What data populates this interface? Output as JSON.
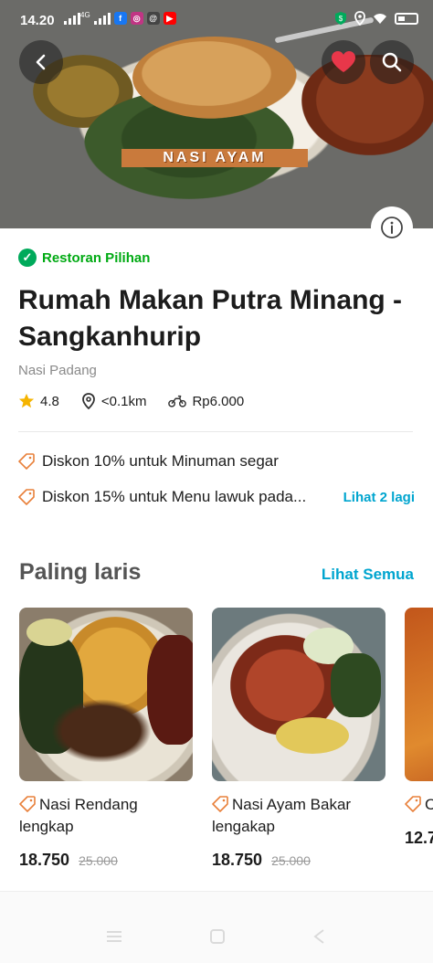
{
  "status_bar": {
    "time": "14.20",
    "network": "4G",
    "apps": [
      {
        "name": "facebook-icon",
        "glyph": "f",
        "color": "#1877f2"
      },
      {
        "name": "instagram-icon",
        "glyph": "◎",
        "color": "#c13584"
      },
      {
        "name": "threads-icon",
        "glyph": "@",
        "color": "#333333"
      },
      {
        "name": "youtube-icon",
        "glyph": "▶",
        "color": "#ff0000"
      }
    ]
  },
  "hero": {
    "caption": "NASI AYAM"
  },
  "restaurant": {
    "badge": "Restoran Pilihan",
    "name": "Rumah Makan Putra Minang - Sangkanhurip",
    "cuisine": "Nasi Padang",
    "rating": "4.8",
    "distance": "<0.1km",
    "delivery_fee": "Rp6.000"
  },
  "promos": [
    {
      "text": "Diskon 10% untuk Minuman segar"
    },
    {
      "text": "Diskon 15% untuk Menu lawuk pada..."
    }
  ],
  "promos_more": "Lihat 2 lagi",
  "bestseller": {
    "title": "Paling laris",
    "see_all": "Lihat Semua",
    "items": [
      {
        "name": "Nasi Rendang lengkap",
        "price": "18.750",
        "original_price": "25.000"
      },
      {
        "name": "Nasi Ayam Bakar lengakap",
        "price": "18.750",
        "original_price": "25.000"
      },
      {
        "name": "C pors",
        "price": "12.7"
      }
    ]
  },
  "colors": {
    "accent_green": "#00aa13",
    "link_blue": "#00a5cf",
    "heart_red": "#e8374a",
    "tag_orange": "#e8803a"
  }
}
